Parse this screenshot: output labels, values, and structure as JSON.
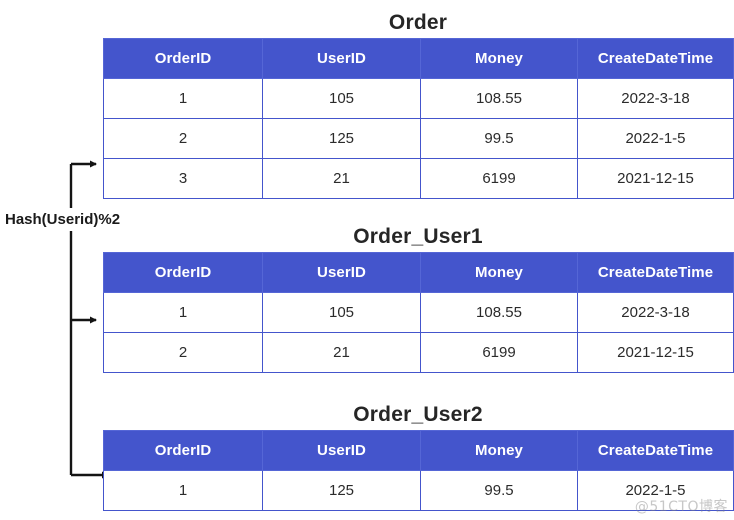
{
  "diagram": {
    "hash_label": "Hash(Userid)%2",
    "watermark": "@51CTO博客",
    "accent_color": "#4455cc",
    "title_color": "#262626",
    "connector_color": "#141414"
  },
  "columns": [
    "OrderID",
    "UserID",
    "Money",
    "CreateDateTime"
  ],
  "tables": [
    {
      "title": "Order",
      "headers": [
        "OrderID",
        "UserID",
        "Money",
        "CreateDateTime"
      ],
      "rows": [
        [
          "1",
          "105",
          "108.55",
          "2022-3-18"
        ],
        [
          "2",
          "125",
          "99.5",
          "2022-1-5"
        ],
        [
          "3",
          "21",
          "6199",
          "2021-12-15"
        ]
      ]
    },
    {
      "title": "Order_User1",
      "headers": [
        "OrderID",
        "UserID",
        "Money",
        "CreateDateTime"
      ],
      "rows": [
        [
          "1",
          "105",
          "108.55",
          "2022-3-18"
        ],
        [
          "2",
          "21",
          "6199",
          "2021-12-15"
        ]
      ]
    },
    {
      "title": "Order_User2",
      "headers": [
        "OrderID",
        "UserID",
        "Money",
        "CreateDateTime"
      ],
      "rows": [
        [
          "1",
          "125",
          "99.5",
          "2022-1-5"
        ]
      ]
    }
  ]
}
